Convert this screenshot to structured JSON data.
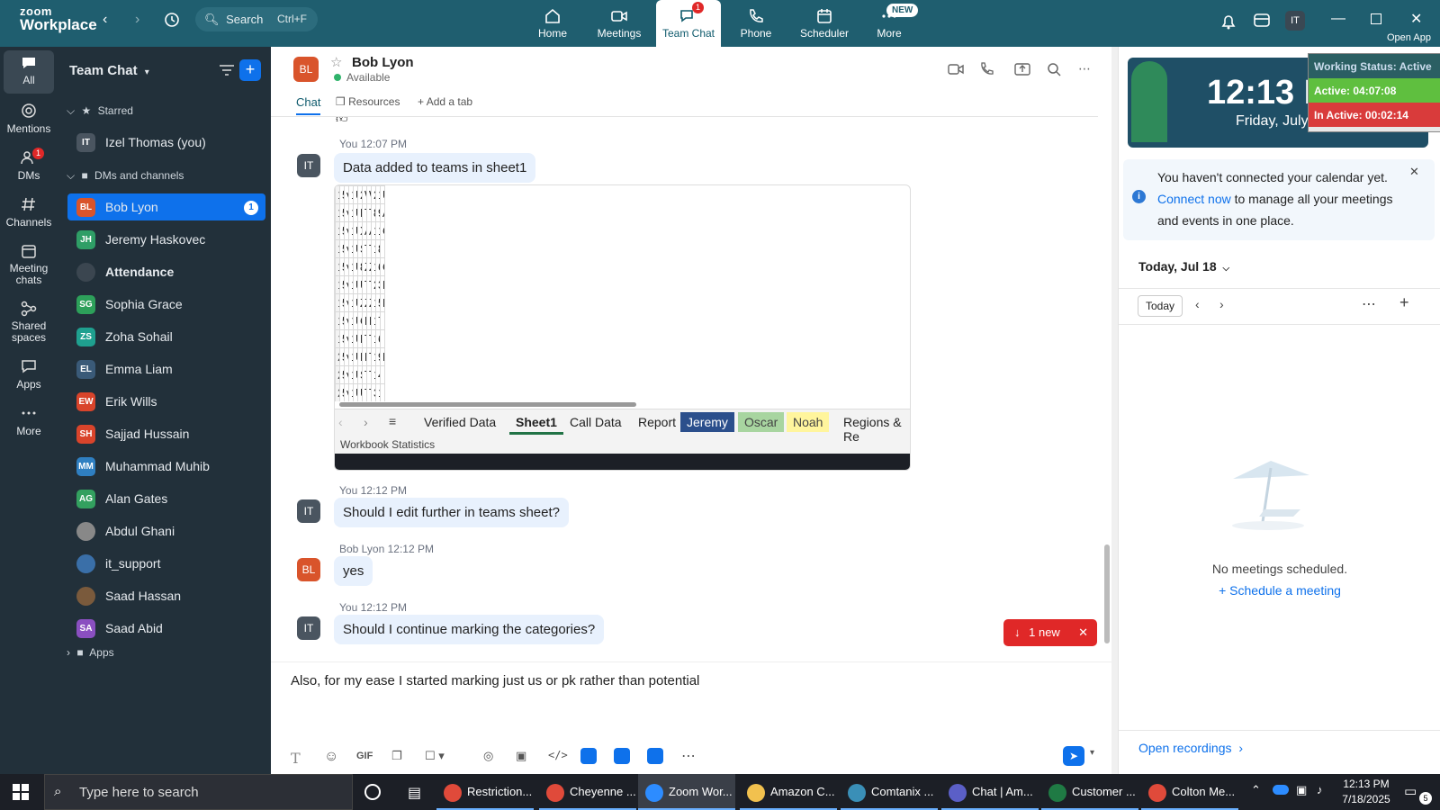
{
  "app": {
    "brand_top": "zoom",
    "brand_bottom": "Workplace"
  },
  "topbar": {
    "search_label": "Search",
    "search_shortcut": "Ctrl+F",
    "tabs": [
      {
        "label": "Home",
        "icon": "home-icon"
      },
      {
        "label": "Meetings",
        "icon": "video-camera-icon"
      },
      {
        "label": "Team Chat",
        "icon": "chat-bubbles-icon",
        "badge": "1",
        "active": true
      },
      {
        "label": "Phone",
        "icon": "phone-icon"
      },
      {
        "label": "Scheduler",
        "icon": "calendar-icon"
      },
      {
        "label": "More",
        "icon": "more-icon",
        "badge": "NEW"
      }
    ],
    "avatar": "IT",
    "open_app": "Open App"
  },
  "rail": {
    "items": [
      {
        "label": "All",
        "active": true
      },
      {
        "label": "Mentions"
      },
      {
        "label": "DMs",
        "badge": "1"
      },
      {
        "label": "Channels"
      },
      {
        "label": "Meeting chats"
      },
      {
        "label": "Shared spaces"
      },
      {
        "label": "Apps"
      },
      {
        "label": "More"
      }
    ]
  },
  "sidebar": {
    "title": "Team Chat",
    "starred_label": "Starred",
    "dms_label": "DMs and channels",
    "apps_label": "Apps",
    "starred": [
      {
        "initials": "IT",
        "name": "Izel Thomas (you)",
        "color": "#4a5560"
      }
    ],
    "contacts": [
      {
        "initials": "BL",
        "name": "Bob Lyon",
        "color": "#d9542b",
        "badge": "1",
        "selected": true
      },
      {
        "initials": "JH",
        "name": "Jeremy Haskovec",
        "color": "#2f9e66"
      },
      {
        "initials": "",
        "name": "Attendance",
        "color": "#3b4650",
        "bold": true
      },
      {
        "initials": "SG",
        "name": "Sophia Grace",
        "color": "#2da05a"
      },
      {
        "initials": "ZS",
        "name": "Zoha Sohail",
        "color": "#1fa08f"
      },
      {
        "initials": "EL",
        "name": "Emma Liam",
        "color": "#3a5a78"
      },
      {
        "initials": "EW",
        "name": "Erik Wills",
        "color": "#d9442b"
      },
      {
        "initials": "SH",
        "name": "Sajjad Hussain",
        "color": "#d9442b"
      },
      {
        "initials": "MM",
        "name": "Muhammad Muhib",
        "color": "#2f7fc1"
      },
      {
        "initials": "AG",
        "name": "Alan Gates",
        "color": "#33a05f"
      },
      {
        "initials": "",
        "name": "Abdul Ghani",
        "color": "#888888"
      },
      {
        "initials": "",
        "name": "it_support",
        "color": "#3a6fa8"
      },
      {
        "initials": "",
        "name": "Saad Hassan",
        "color": "#7a5a3c"
      },
      {
        "initials": "SA",
        "name": "Saad Abid",
        "color": "#8a4fc0"
      }
    ]
  },
  "chat": {
    "contact_name": "Bob Lyon",
    "contact_initials": "BL",
    "status": "Available",
    "tabs": {
      "chat": "Chat",
      "resources": "Resources",
      "add": "Add a tab"
    },
    "messages": [
      {
        "sender": "You",
        "time": "12:07 PM",
        "initials": "IT",
        "text": "Data added to teams in sheet1"
      },
      {
        "sender": "You",
        "time": "12:12 PM",
        "initials": "IT",
        "text": "Should I edit further in teams sheet?"
      },
      {
        "sender": "Bob Lyon",
        "time": "12:12 PM",
        "initials": "BL",
        "text": "yes"
      },
      {
        "sender": "You",
        "time": "12:12 PM",
        "initials": "IT",
        "text": "Should I continue marking the categories?"
      }
    ],
    "new_pill": "1 new",
    "composer_text": "Also, for my ease I started marking just us or pk rather than potential"
  },
  "sheet": {
    "rows": [
      [
        "11",
        "5/5/2025",
        "vCloud Ch",
        "111-0804",
        "US-Q2-25-",
        "2731606C",
        "Wenger Ib",
        "Wenger",
        "2",
        "155.32",
        "US"
      ],
      [
        "12",
        "5/7/2025",
        "vCloud Ch",
        "113-5976",
        "US-Q2-25-",
        "N235-D01",
        "Tripp Lite D",
        "TrippLite",
        "8",
        "99.68",
        "AM"
      ],
      [
        "13",
        "5/9/2025",
        "vCloud Tec",
        "111-8365",
        "US-Q2-25-",
        "X128R",
        "Algo X128I",
        "Algo",
        "1",
        "18.89",
        "Cel"
      ],
      [
        "14",
        "5/10/2025",
        "vCloud Ch",
        "114-1223",
        "US-Q2-25-",
        "SPIKECUB",
        "Tripp Lite 1",
        "TrippLite",
        "1",
        "8.51",
        ""
      ],
      [
        "15",
        "5/12/2025",
        "vCloud Ch",
        "112-8911",
        "US-Q2-25-",
        "800322-12",
        "Zebra Tech",
        "Zebra",
        "1",
        "63.81",
        "City"
      ],
      [
        "16",
        "5/13/2025",
        "vCloud Ch",
        "113-8419",
        "US-Q2-25-",
        "U336-000-",
        "Tripp Lite U",
        "TrippLite",
        "2",
        "38.32",
        "BTS"
      ],
      [
        "17",
        "5/13/2025",
        "vCloud Ch",
        "112-6595",
        "US-Q2-25-",
        "ZD6A042-I",
        "ZEBRA ZD6",
        "Zebra",
        "1",
        "552.99",
        "Kai"
      ],
      [
        "18",
        "5/17/2025",
        "vCloud Tec",
        "114-6221",
        "US-Q2-25-",
        "CUBI13M0",
        "MSI Cubi N",
        "MSI",
        "1",
        "773.1",
        ""
      ],
      [
        "19",
        "5/17/2025",
        "vCloud Ch",
        "111-0190",
        "US-Q2-25-",
        "P581AB-0",
        "Tripp Lite S",
        "TrippLite",
        "1",
        "6.79",
        ""
      ],
      [
        "20",
        "5/19/2025",
        "vCloud Ch",
        "112-7757",
        "US-Q2-25-",
        "P006-L06",
        "Power Exte",
        "TrippLite",
        "10",
        "94.7",
        "Pac"
      ],
      [
        "21",
        "5/19/2025",
        "vCloud Ch",
        "111-0165",
        "US-Q2-25-",
        "SRW12US",
        "Tripp Lite 1",
        "TrippLite",
        "1",
        "485.28",
        ""
      ],
      [
        "22",
        "5/20/2025",
        "vCloud Ch",
        "113-0649",
        "US-Q2-25-",
        "UR022-01",
        "Tripp Lite U",
        "TrippLite",
        "3",
        "13.8",
        ""
      ]
    ],
    "tabs": [
      {
        "label": "Verified Data"
      },
      {
        "label": "Sheet1",
        "active": true
      },
      {
        "label": "Call Data"
      },
      {
        "label": "Report"
      },
      {
        "label": "Jeremy",
        "bg": "#2b4f8c",
        "fg": "#ffffff"
      },
      {
        "label": "Oscar",
        "bg": "#a8d5a0",
        "fg": "#444444"
      },
      {
        "label": "Noah",
        "bg": "#fff59d",
        "fg": "#444444"
      },
      {
        "label": "Regions & Re"
      }
    ],
    "status": "Workbook Statistics"
  },
  "right": {
    "clock": "12:13 PM",
    "date": "Friday, July 18",
    "working_status": "Working Status: Active",
    "active": "Active: 04:07:08",
    "inactive": "In Active: 00:02:14",
    "calendar_notice_1": "You haven't connected your calendar yet.",
    "calendar_link": "Connect now",
    "calendar_notice_2": "to manage all your meetings and events in one place.",
    "today_header": "Today, Jul 18",
    "today_btn": "Today",
    "no_meetings": "No meetings scheduled.",
    "schedule": "Schedule a meeting",
    "open_recordings": "Open recordings"
  },
  "taskbar": {
    "search": "Type here to search",
    "items": [
      {
        "label": "Restriction...",
        "color": "#e04a3a"
      },
      {
        "label": "Cheyenne ...",
        "color": "#e04a3a"
      },
      {
        "label": "Zoom Wor...",
        "color": "#2d8cff",
        "active": true
      },
      {
        "label": "Amazon C...",
        "color": "#f2c14e"
      },
      {
        "label": "Comtanix ...",
        "color": "#3a8fb7"
      },
      {
        "label": "Chat | Am...",
        "color": "#5b5fc7"
      },
      {
        "label": "Customer ...",
        "color": "#1f7a44"
      },
      {
        "label": "Colton Me...",
        "color": "#e04a3a"
      }
    ],
    "time": "12:13 PM",
    "date": "7/18/2025",
    "notif": "5"
  }
}
